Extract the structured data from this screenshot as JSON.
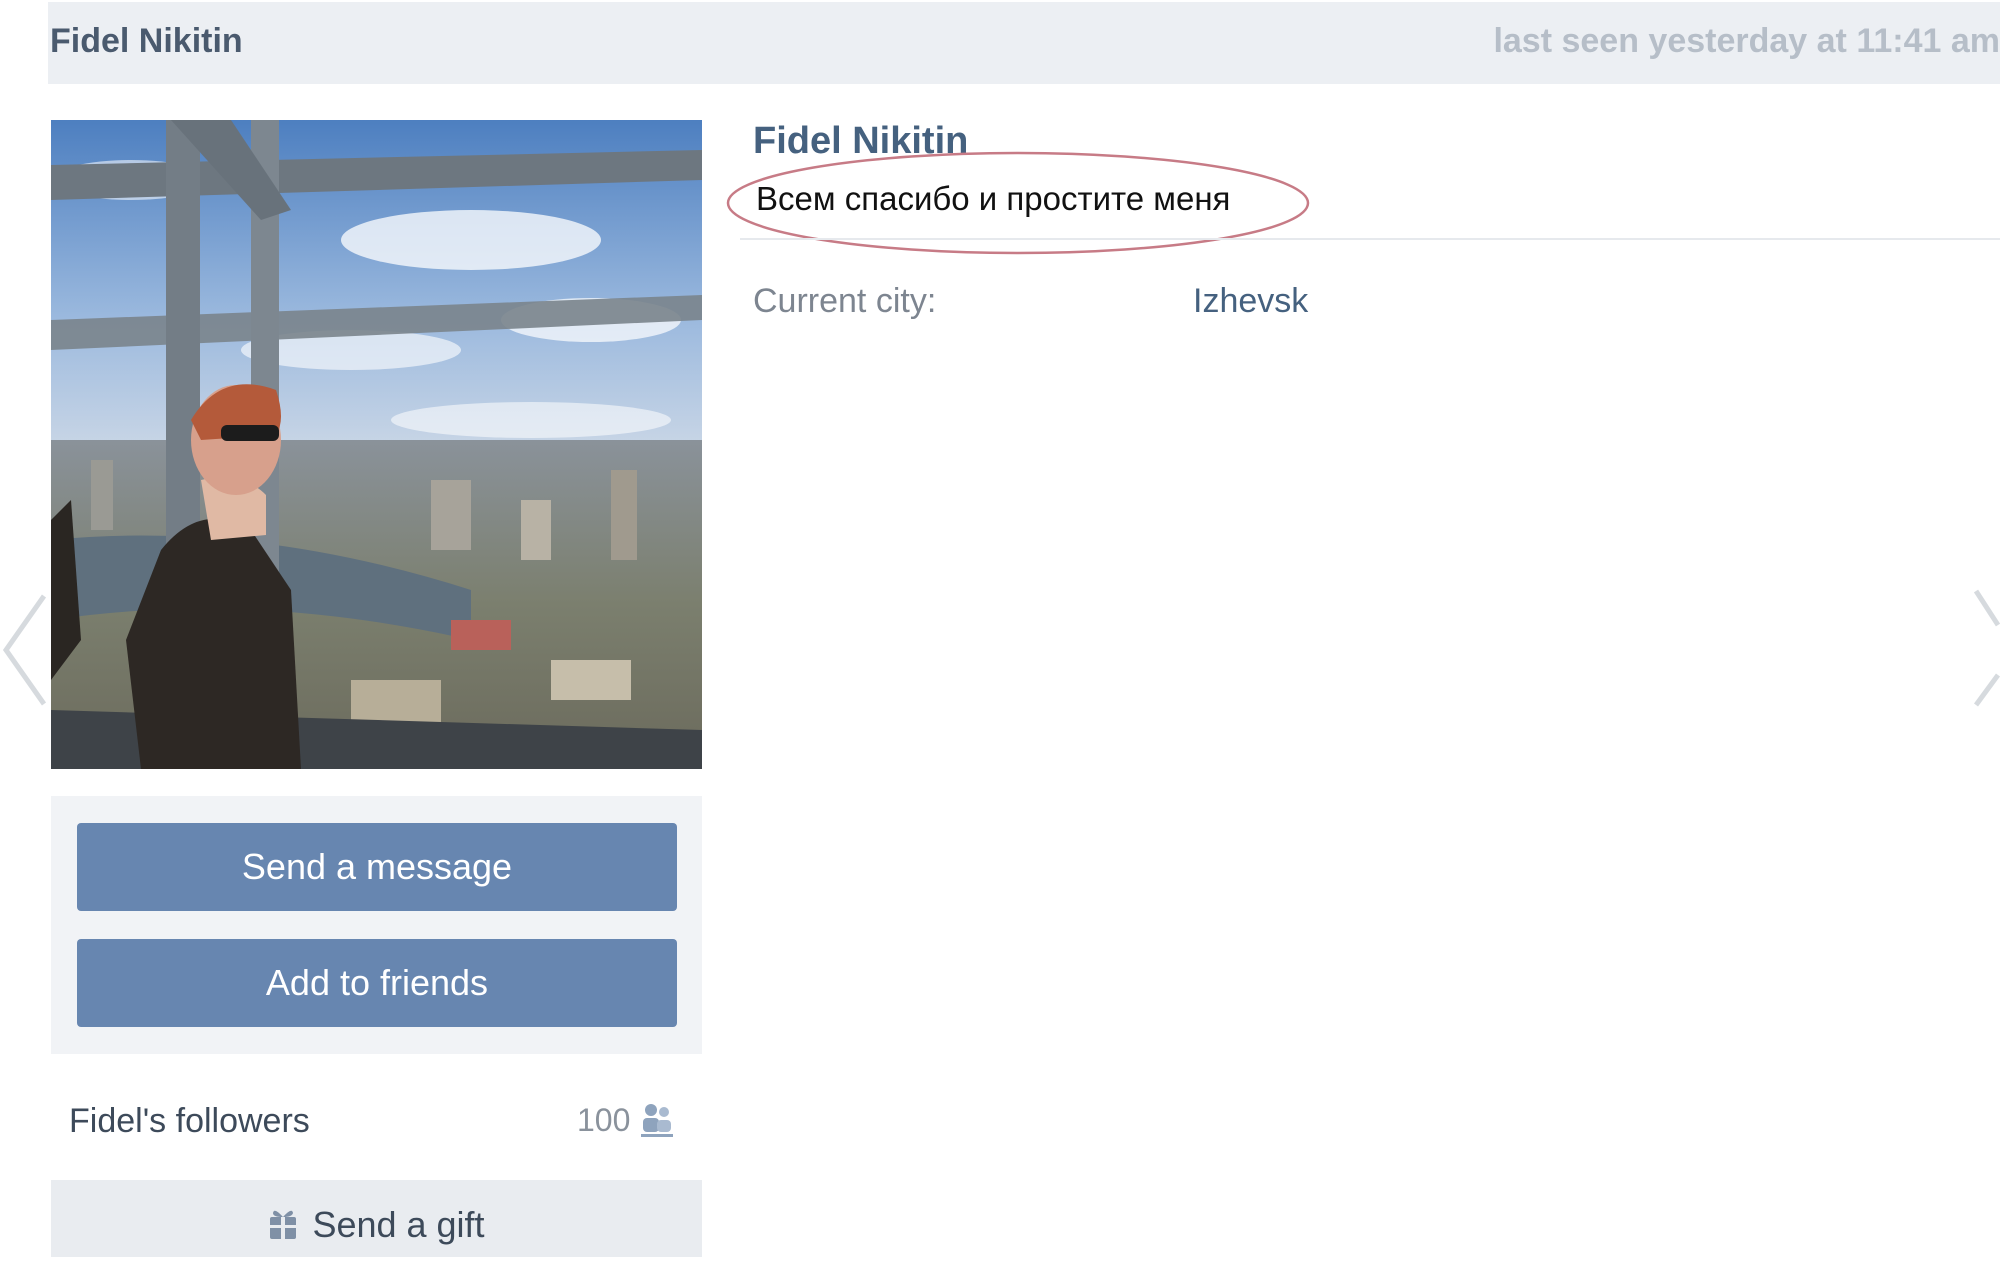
{
  "header": {
    "name": "Fidel Nikitin",
    "last_seen": "last seen yesterday at 11:41 am"
  },
  "profile": {
    "name": "Fidel Nikitin",
    "status": "Всем спасибо и простите меня",
    "city_label": "Current city:",
    "city_value": "Izhevsk"
  },
  "actions": {
    "send_message": "Send a message",
    "add_friends": "Add to friends"
  },
  "followers": {
    "label": "Fidel's followers",
    "count": "100"
  },
  "gift": {
    "label": "Send a gift"
  },
  "icons": {
    "followers": "followers-icon",
    "gift": "gift-icon",
    "prev": "chevron-left-icon",
    "next": "chevron-right-icon"
  },
  "colors": {
    "button": "#6786b0",
    "topbar": "#eceff3",
    "name": "#45617f",
    "status_highlight": "#c77b86"
  }
}
